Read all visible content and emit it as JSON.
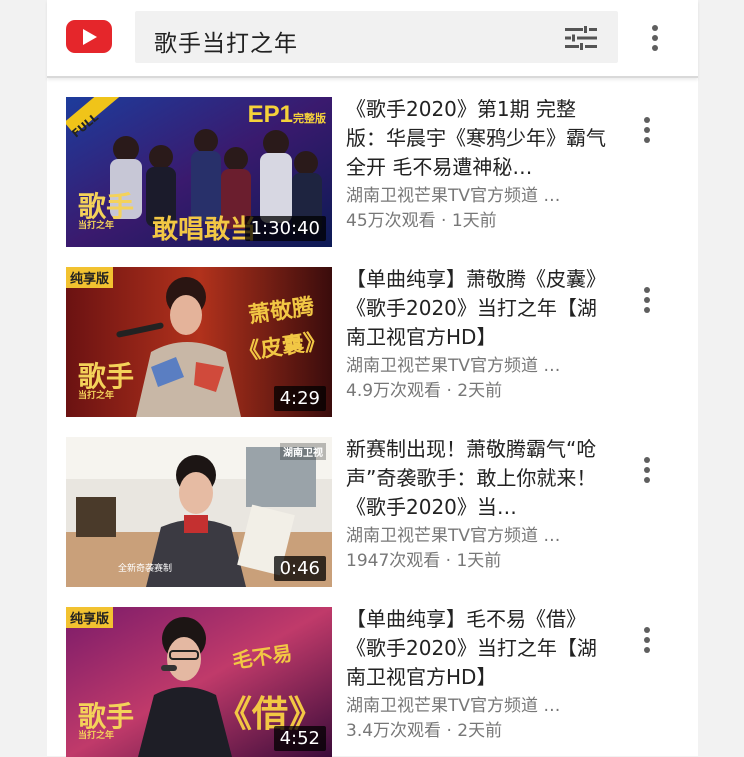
{
  "search": {
    "query": "歌手当打之年"
  },
  "icons": {
    "logo": "youtube-logo-icon",
    "filter": "tune-icon",
    "more": "more-vert-icon"
  },
  "colors": {
    "brand_red": "#e5262b",
    "meta_text": "#777777"
  },
  "videos": [
    {
      "title": "《歌手2020》第1期 完整版：华晨宇《寒鸦少年》霸气全开 毛不易遭神秘…",
      "channel": "湖南卫视芒果TV官方频道 …",
      "stats": "45万次观看 · 1天前",
      "duration": "1:30:40",
      "thumb_badge": "FULL",
      "thumb_episode": "EP1",
      "thumb_episode_sub": "完整版",
      "thumb_show": "歌手",
      "thumb_show_sub": "当打之年",
      "thumb_caption": "敢唱敢当"
    },
    {
      "title": "【单曲纯享】萧敬腾《皮囊》《歌手2020》当打之年【湖南卫视官方HD】",
      "channel": "湖南卫视芒果TV官方频道 …",
      "stats": "4.9万次观看 · 2天前",
      "duration": "4:29",
      "thumb_badge": "纯享版",
      "thumb_singer": "萧敬腾",
      "thumb_song": "《皮囊》",
      "thumb_show": "歌手",
      "thumb_show_sub": "当打之年"
    },
    {
      "title": "新赛制出现！萧敬腾霸气“呛声”奇袭歌手：敢上你就来！《歌手2020》当…",
      "channel": "湖南卫视芒果TV官方频道 …",
      "stats": "1947次观看 · 1天前",
      "duration": "0:46",
      "thumb_logo": "湖南卫视",
      "thumb_caption": "全新奇袭赛制"
    },
    {
      "title": "【单曲纯享】毛不易《借》《歌手2020》当打之年【湖南卫视官方HD】",
      "channel": "湖南卫视芒果TV官方频道 …",
      "stats": "3.4万次观看 · 2天前",
      "duration": "4:52",
      "thumb_badge": "纯享版",
      "thumb_singer": "毛不易",
      "thumb_song": "《借》",
      "thumb_show": "歌手",
      "thumb_show_sub": "当打之年"
    }
  ]
}
